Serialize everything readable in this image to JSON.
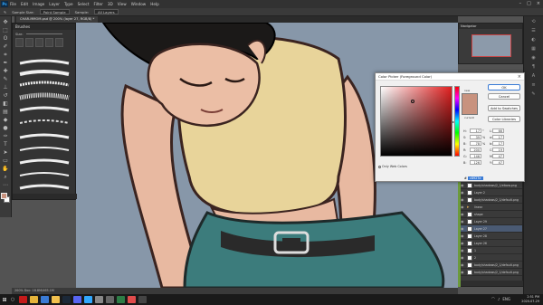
{
  "menu": {
    "app_icon": "Ps",
    "items": [
      "File",
      "Edit",
      "Image",
      "Layer",
      "Type",
      "Select",
      "Filter",
      "3D",
      "View",
      "Window",
      "Help"
    ],
    "window_controls": [
      "–",
      "□",
      "×"
    ]
  },
  "options_bar": {
    "items": [
      "Sample Size:",
      "Point Sample",
      "Sample:",
      "All Layers"
    ]
  },
  "document_tab": "CHAR-MMOM.psd @ 200% (layer 27, RGB/8) *",
  "toolbar": {
    "tools": [
      "move-icon",
      "marquee-icon",
      "lasso-icon",
      "quick-select-icon",
      "crop-icon",
      "eyedropper-icon",
      "healing-icon",
      "brush-icon",
      "stamp-icon",
      "history-brush-icon",
      "eraser-icon",
      "gradient-icon",
      "blur-icon",
      "dodge-icon",
      "pen-icon",
      "type-icon",
      "path-select-icon",
      "shape-icon",
      "hand-icon",
      "zoom-icon",
      "more-icon"
    ]
  },
  "brush_panel": {
    "title": "Brushes",
    "size_label": "Size:"
  },
  "navigator": {
    "title": "Navigator"
  },
  "color_picker": {
    "title": "Color Picker (Foreground Color)",
    "close": "×",
    "new_label": "new",
    "current_label": "current",
    "ok": "OK",
    "cancel": "Cancel",
    "add_swatches": "Add to Swatches",
    "libraries": "Color Libraries",
    "only_web": "Only Web Colors",
    "selected_color": "#c8927e",
    "values": [
      {
        "k": "H:",
        "v": "17",
        "u": "°",
        "k2": "L:",
        "v2": "66"
      },
      {
        "k": "S:",
        "v": "39",
        "u": "%",
        "k2": "a:",
        "v2": "17"
      },
      {
        "k": "B:",
        "v": "78",
        "u": "%",
        "k2": "b:",
        "v2": "17"
      },
      {
        "k": "R:",
        "v": "200",
        "u": "",
        "k2": "C:",
        "v2": "19"
      },
      {
        "k": "G:",
        "v": "146",
        "u": "",
        "k2": "M:",
        "v2": "47"
      },
      {
        "k": "B:",
        "v": "126",
        "u": "",
        "k2": "Y:",
        "v2": "47"
      }
    ],
    "hex_prefix": "#",
    "hex": "c8927e"
  },
  "layers": [
    {
      "name": "body/shadows/2_1/elbow.png",
      "type": "layer",
      "sel": false
    },
    {
      "name": "Layer 2",
      "type": "layer",
      "sel": false
    },
    {
      "name": "body/shadows/2_1/default.png",
      "type": "layer",
      "sel": false
    },
    {
      "name": "linear",
      "type": "group",
      "sel": false
    },
    {
      "name": "shape",
      "type": "layer",
      "sel": false
    },
    {
      "name": "Layer 29",
      "type": "layer",
      "sel": false
    },
    {
      "name": "Layer 27",
      "type": "layer",
      "sel": true
    },
    {
      "name": "Layer 28",
      "type": "layer",
      "sel": false
    },
    {
      "name": "Layer 26",
      "type": "layer",
      "sel": false
    },
    {
      "name": "1",
      "type": "layer",
      "sel": false
    },
    {
      "name": "2",
      "type": "layer",
      "sel": false
    },
    {
      "name": "body/shadows/2_1/default.png",
      "type": "layer",
      "sel": false
    },
    {
      "name": "body/shadows/2_1/default.png",
      "type": "layer",
      "sel": false
    }
  ],
  "status": "200%     Doc: 18.8M/465.1M",
  "taskbar": {
    "apps": [
      {
        "name": "opera",
        "color": "#c41a1a"
      },
      {
        "name": "chrome",
        "color": "#e5b33a"
      },
      {
        "name": "photos",
        "color": "#3a7bd5"
      },
      {
        "name": "files",
        "color": "#f2c14e"
      },
      {
        "name": "steam",
        "color": "#1b2838"
      },
      {
        "name": "discord",
        "color": "#5865f2"
      },
      {
        "name": "photoshop",
        "color": "#31a8ff"
      },
      {
        "name": "app-2",
        "color": "#888888"
      },
      {
        "name": "app-3",
        "color": "#666666"
      },
      {
        "name": "app-4",
        "color": "#2d7d46"
      },
      {
        "name": "app-5",
        "color": "#e14c4c"
      },
      {
        "name": "app-6",
        "color": "#444444"
      }
    ],
    "lang": "ENG",
    "time": "2:51 PM",
    "date": "2020-07-29"
  }
}
